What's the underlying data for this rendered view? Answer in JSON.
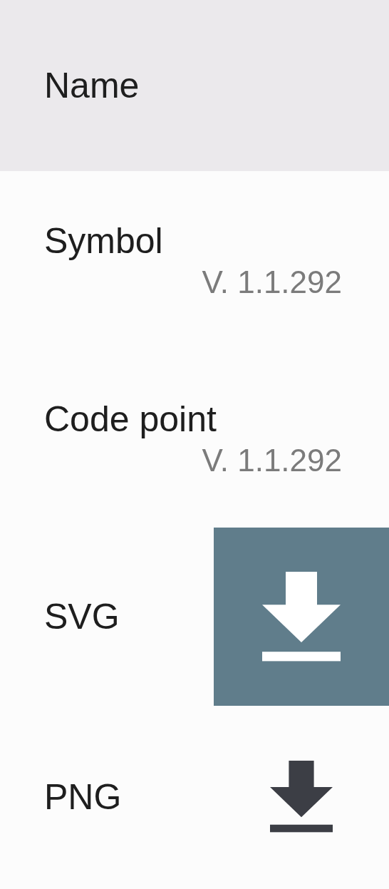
{
  "header": {
    "label": "Name"
  },
  "rows": [
    {
      "kind": "text",
      "label": "Symbol",
      "version": "V. 1.1.292"
    },
    {
      "kind": "text",
      "label": "Code point",
      "version": "V. 1.1.292"
    },
    {
      "kind": "download",
      "label": "SVG",
      "highlighted": true
    },
    {
      "kind": "download",
      "label": "PNG",
      "highlighted": false
    }
  ]
}
